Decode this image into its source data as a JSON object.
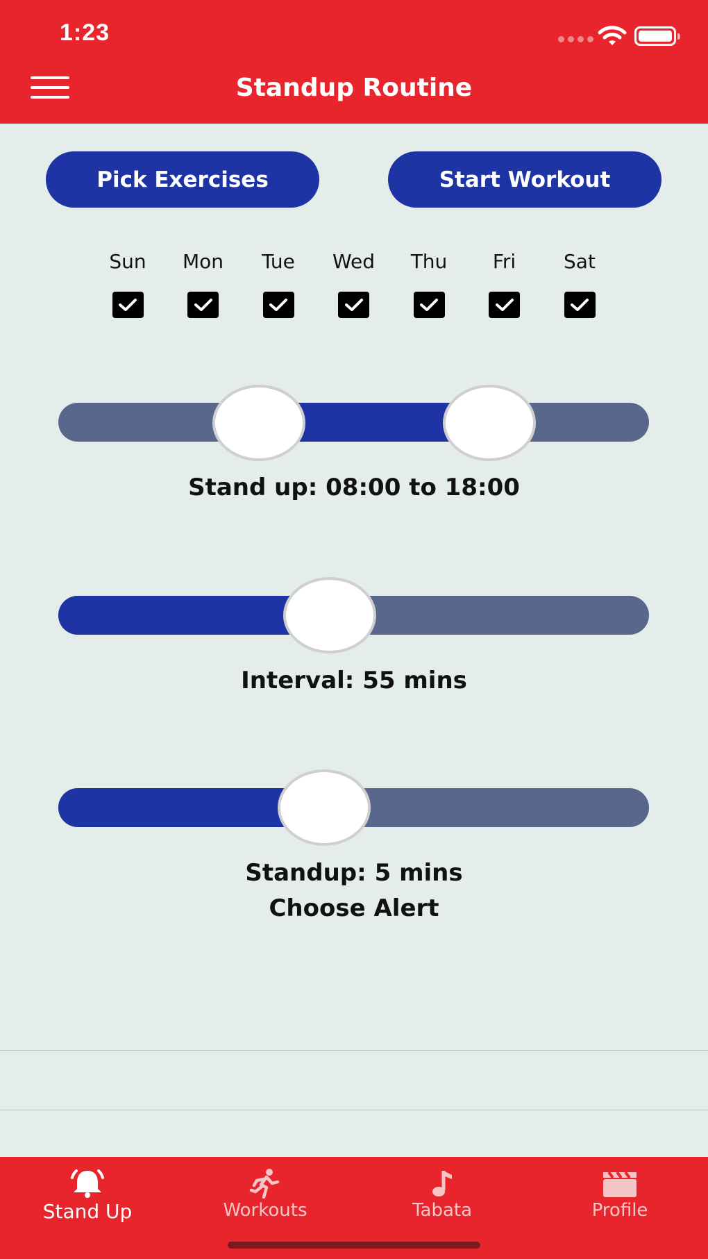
{
  "status_bar": {
    "time": "1:23"
  },
  "header": {
    "title": "Standup Routine",
    "menu_icon": "hamburger-menu-icon"
  },
  "actions": {
    "pick_exercises": "Pick Exercises",
    "start_workout": "Start Workout"
  },
  "days": [
    {
      "label": "Sun",
      "checked": true
    },
    {
      "label": "Mon",
      "checked": true
    },
    {
      "label": "Tue",
      "checked": true
    },
    {
      "label": "Wed",
      "checked": true
    },
    {
      "label": "Thu",
      "checked": true
    },
    {
      "label": "Fri",
      "checked": true
    },
    {
      "label": "Sat",
      "checked": true
    }
  ],
  "standup_range": {
    "label": "Stand up: 08:00 to 18:00",
    "low_fraction": 0.34,
    "high_fraction": 0.73
  },
  "interval": {
    "label": "Interval: 55 mins",
    "fraction": 0.46
  },
  "standup_duration": {
    "label": "Standup: 5 mins",
    "fraction": 0.45
  },
  "alert": {
    "label": "Choose Alert"
  },
  "tabs": [
    {
      "label": "Stand Up",
      "icon": "bell-icon",
      "active": true
    },
    {
      "label": "Workouts",
      "icon": "running-person-icon",
      "active": false
    },
    {
      "label": "Tabata",
      "icon": "music-note-icon",
      "active": false
    },
    {
      "label": "Profile",
      "icon": "clapperboard-icon",
      "active": false
    }
  ],
  "colors": {
    "brand_red": "#e8252c",
    "accent_blue": "#1e34a4",
    "track_grey_blue": "#58678b",
    "background": "#e4ede9"
  }
}
